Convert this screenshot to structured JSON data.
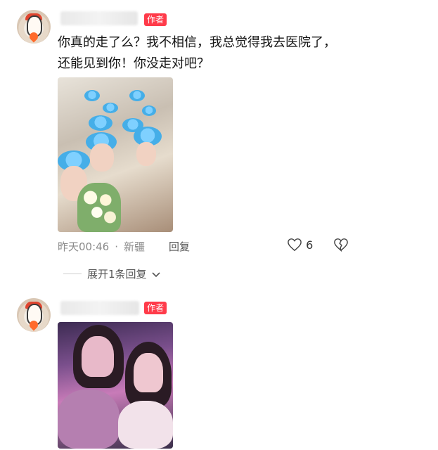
{
  "comments": [
    {
      "badge": "作者",
      "name_tail": "",
      "text": "你真的走了么？我不相信，我总觉得我去医院了，还能见到你！你没走对吧？",
      "time": "昨天00:46",
      "location": "新疆",
      "reply_label": "回复",
      "likes": "6",
      "expand_label": "展开1条回复"
    },
    {
      "badge": "作者"
    }
  ],
  "colors": {
    "badge": "#ff3b4a",
    "meta_text": "#8a8a8a"
  }
}
